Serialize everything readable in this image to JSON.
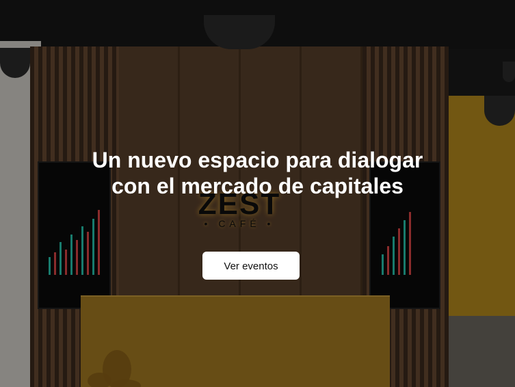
{
  "hero": {
    "headline_line1": "Un nuevo espacio para dialogar",
    "headline_line2": "con el mercado de capitales",
    "cta_label": "Ver eventos"
  },
  "background": {
    "logo_main": "ZEST",
    "logo_sub": "• CAFÉ •"
  },
  "colors": {
    "accent_wood": "#6a4b33",
    "accent_yellow": "#b88d1e",
    "button_bg": "#ffffff",
    "headline": "#ffffff"
  }
}
